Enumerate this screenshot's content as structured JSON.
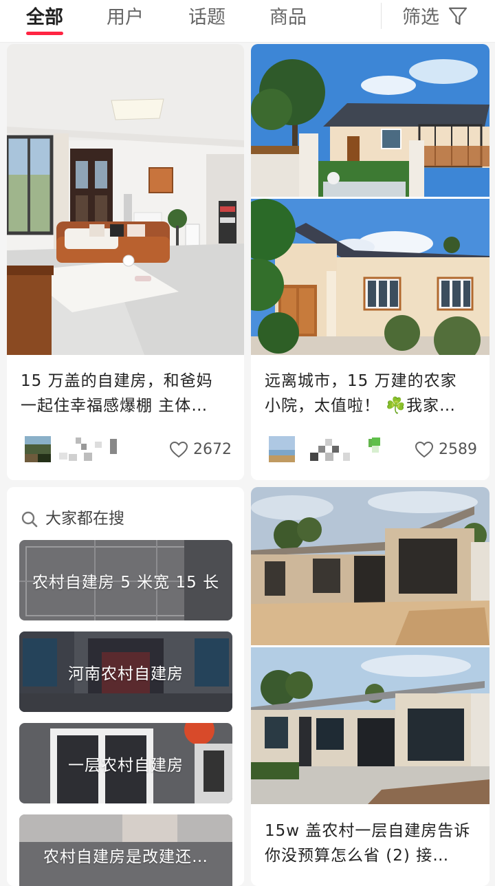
{
  "tabs": {
    "all": "全部",
    "users": "用户",
    "topics": "话题",
    "products": "商品",
    "filter": "筛选"
  },
  "accent": "#ff2442",
  "feed": {
    "card1": {
      "title_line1": "15 万盖的自建房，和爸妈",
      "title_line2": "一起住幸福感爆棚 主体…",
      "likes": "2672"
    },
    "card2": {
      "title_line1": "远离城市，15 万建的农家",
      "title_line2": "小院，太值啦！ ☘️我家…",
      "likes": "2589"
    },
    "suggest": {
      "heading": "大家都在搜",
      "items": [
        "农村自建房 5 米宽 15 长",
        "河南农村自建房",
        "一层农村自建房",
        "农村自建房是改建还…"
      ]
    },
    "card3": {
      "title_line1": "15w 盖农村一层自建房告诉",
      "title_line2": "你没预算怎么省 (2) 接…"
    }
  },
  "icons": {
    "filter": "funnel-icon",
    "like": "heart-outline-icon",
    "search": "search-icon"
  }
}
